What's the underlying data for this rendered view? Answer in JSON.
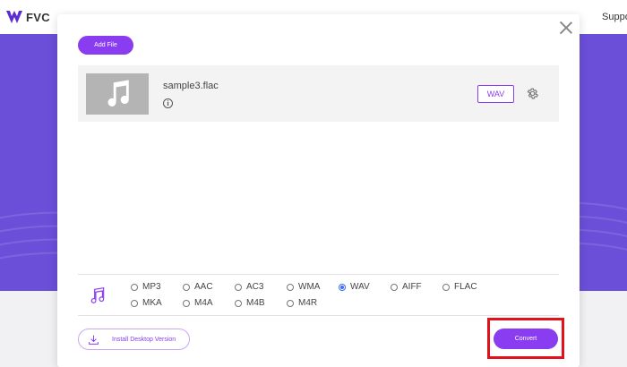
{
  "site": {
    "brand_name": "FVC",
    "nav_support": "Suppo",
    "colors": {
      "band": "#6b4fd8",
      "accent": "#8a3cf0",
      "highlight": "#e3121a"
    }
  },
  "dialog": {
    "add_file_label": "Add File",
    "file": {
      "name": "sample3.flac",
      "output_format": "WAV",
      "info_icon": "info-icon",
      "settings_icon": "gear-icon"
    },
    "formats": {
      "selected": "WAV",
      "row1": [
        "MP3",
        "AAC",
        "AC3",
        "WMA",
        "WAV",
        "AIFF",
        "FLAC"
      ],
      "row2": [
        "MKA",
        "M4A",
        "M4B",
        "M4R"
      ]
    },
    "install_label": "Install Desktop Version",
    "convert_label": "Convert"
  }
}
